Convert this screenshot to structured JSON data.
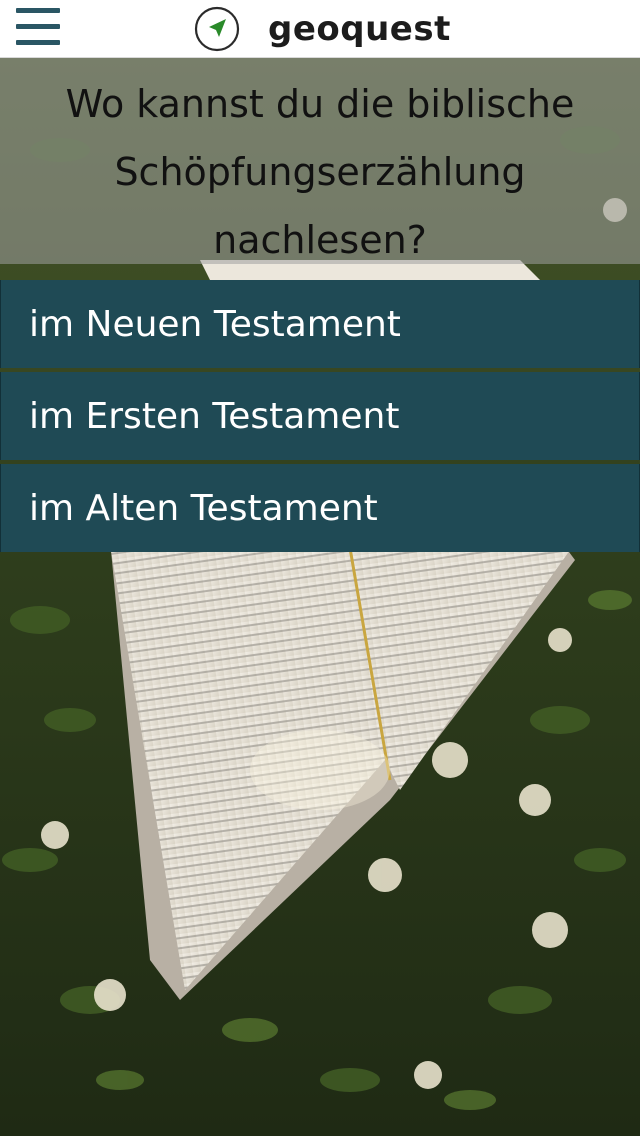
{
  "header": {
    "app_name": "geoquest",
    "menu_icon": "hamburger-menu-icon",
    "logo_icon": "navigation-arrow-icon"
  },
  "question": {
    "line1": "Wo kannst du die biblische",
    "line2": "Schöpfungserzählung",
    "line3": "nachlesen?"
  },
  "answers": [
    {
      "label": "im Neuen Testament"
    },
    {
      "label": "im Ersten Testament"
    },
    {
      "label": "im Alten Testament"
    }
  ],
  "colors": {
    "accent": "#2a5664",
    "answer_bg": "#1f4a55",
    "header_bg": "#ffffff"
  }
}
